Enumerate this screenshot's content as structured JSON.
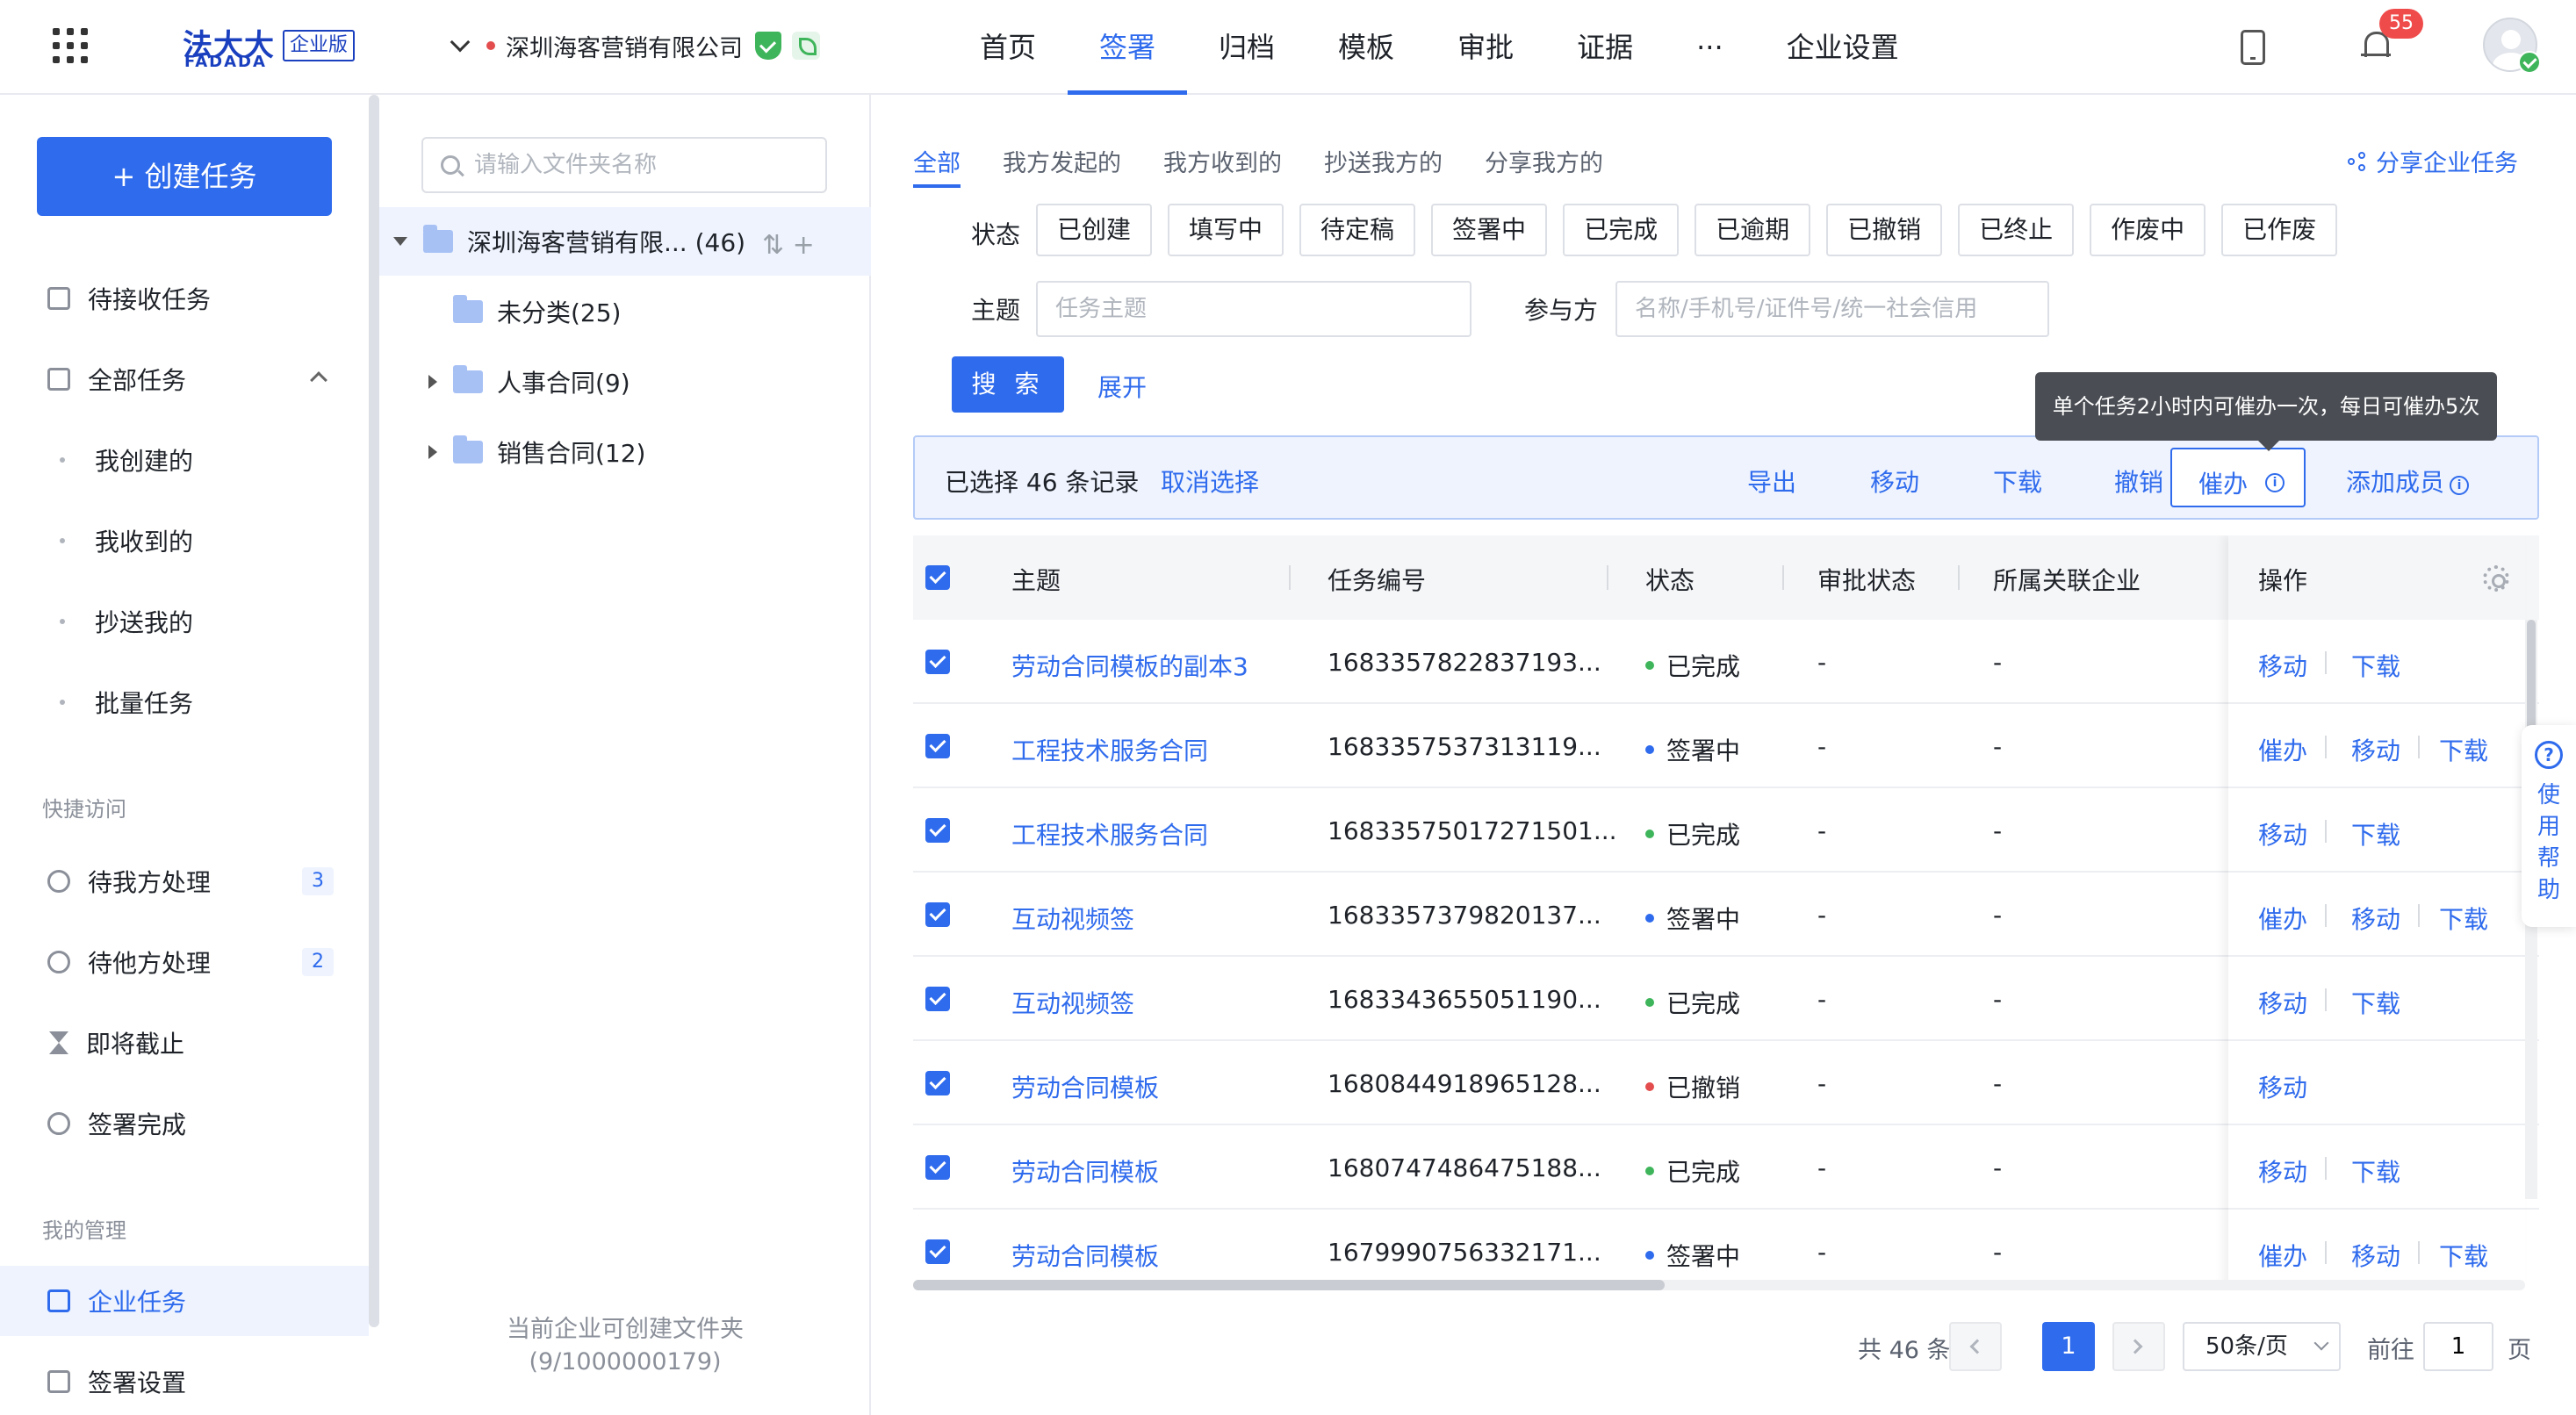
{
  "header": {
    "logo_cn": "法大大",
    "logo_en": "FADADA",
    "logo_badge": "企业版",
    "company": "深圳海客营销有限公司",
    "nav": [
      "首页",
      "签署",
      "归档",
      "模板",
      "审批",
      "证据",
      "···",
      "企业设置"
    ],
    "active_nav": "签署",
    "notification_count": "55"
  },
  "sidebar": {
    "create_label": "+ 创建任务",
    "items": [
      "待接收任务",
      "全部任务"
    ],
    "sub_items": [
      "我创建的",
      "我收到的",
      "抄送我的",
      "批量任务"
    ],
    "quick_section": "快捷访问",
    "quick_items": [
      {
        "label": "待我方处理",
        "count": "3"
      },
      {
        "label": "待他方处理",
        "count": "2"
      },
      {
        "label": "即将截止",
        "count": ""
      },
      {
        "label": "签署完成",
        "count": ""
      }
    ],
    "manage_section": "我的管理",
    "manage_items": [
      "企业任务",
      "签署设置"
    ],
    "active_item": "企业任务"
  },
  "folders": {
    "search_placeholder": "请输入文件夹名称",
    "root": "深圳海客营销有限... (46)",
    "root_tools": "⇅ +",
    "children": [
      "未分类(25)",
      "人事合同(9)",
      "销售合同(12)"
    ],
    "note_line1": "当前企业可创建文件夹",
    "note_line2": "(9/1000000179)"
  },
  "main": {
    "tabs": [
      "全部",
      "我方发起的",
      "我方收到的",
      "抄送我方的",
      "分享我方的"
    ],
    "active_tab": "全部",
    "share_label": "分享企业任务",
    "status_label": "状态",
    "statuses": [
      "已创建",
      "填写中",
      "待定稿",
      "签署中",
      "已完成",
      "已逾期",
      "已撤销",
      "已终止",
      "作废中",
      "已作废"
    ],
    "subject_label": "主题",
    "subject_placeholder": "任务主题",
    "party_label": "参与方",
    "party_placeholder": "名称/手机号/证件号/统一社会信用",
    "search_label": "搜 索",
    "expand_label": "展开",
    "tooltip": "单个任务2小时内可催办一次，每日可催办5次",
    "selection": {
      "text": "已选择 46 条记录",
      "cancel": "取消选择",
      "actions": [
        "导出",
        "移动",
        "下载",
        "撤销",
        "催办",
        "添加成员"
      ]
    },
    "columns": [
      "主题",
      "任务编号",
      "状态",
      "审批状态",
      "所属关联企业",
      "操作"
    ],
    "rows": [
      {
        "title": "劳动合同模板的副本3",
        "num": "1683357822837193...",
        "status": "已完成",
        "color": "#3fb55b",
        "approval": "-",
        "corp": "-",
        "ops": [
          "移动",
          "下载"
        ]
      },
      {
        "title": "工程技术服务合同",
        "num": "1683357537313119...",
        "status": "签署中",
        "color": "#2f6bed",
        "approval": "-",
        "corp": "-",
        "ops": [
          "催办",
          "移动",
          "下载"
        ]
      },
      {
        "title": "工程技术服务合同",
        "num": "16833575017271501...",
        "status": "已完成",
        "color": "#3fb55b",
        "approval": "-",
        "corp": "-",
        "ops": [
          "移动",
          "下载"
        ]
      },
      {
        "title": "互动视频签",
        "num": "1683357379820137...",
        "status": "签署中",
        "color": "#2f6bed",
        "approval": "-",
        "corp": "-",
        "ops": [
          "催办",
          "移动",
          "下载"
        ]
      },
      {
        "title": "互动视频签",
        "num": "1683343655051190...",
        "status": "已完成",
        "color": "#3fb55b",
        "approval": "-",
        "corp": "-",
        "ops": [
          "移动",
          "下载"
        ]
      },
      {
        "title": "劳动合同模板",
        "num": "1680844918965128...",
        "status": "已撤销",
        "color": "#e34d4d",
        "approval": "-",
        "corp": "-",
        "ops": [
          "移动"
        ]
      },
      {
        "title": "劳动合同模板",
        "num": "1680747486475188...",
        "status": "已完成",
        "color": "#3fb55b",
        "approval": "-",
        "corp": "-",
        "ops": [
          "移动",
          "下载"
        ]
      },
      {
        "title": "劳动合同模板",
        "num": "1679990756332171...",
        "status": "签署中",
        "color": "#2f6bed",
        "approval": "-",
        "corp": "-",
        "ops": [
          "催办",
          "移动",
          "下载"
        ]
      }
    ],
    "pagination": {
      "total": "共 46 条",
      "current": "1",
      "page_size": "50条/页",
      "goto_label": "前往",
      "goto_value": "1",
      "page_unit": "页"
    }
  },
  "help": {
    "label": "使用帮助",
    "icon": "?"
  }
}
